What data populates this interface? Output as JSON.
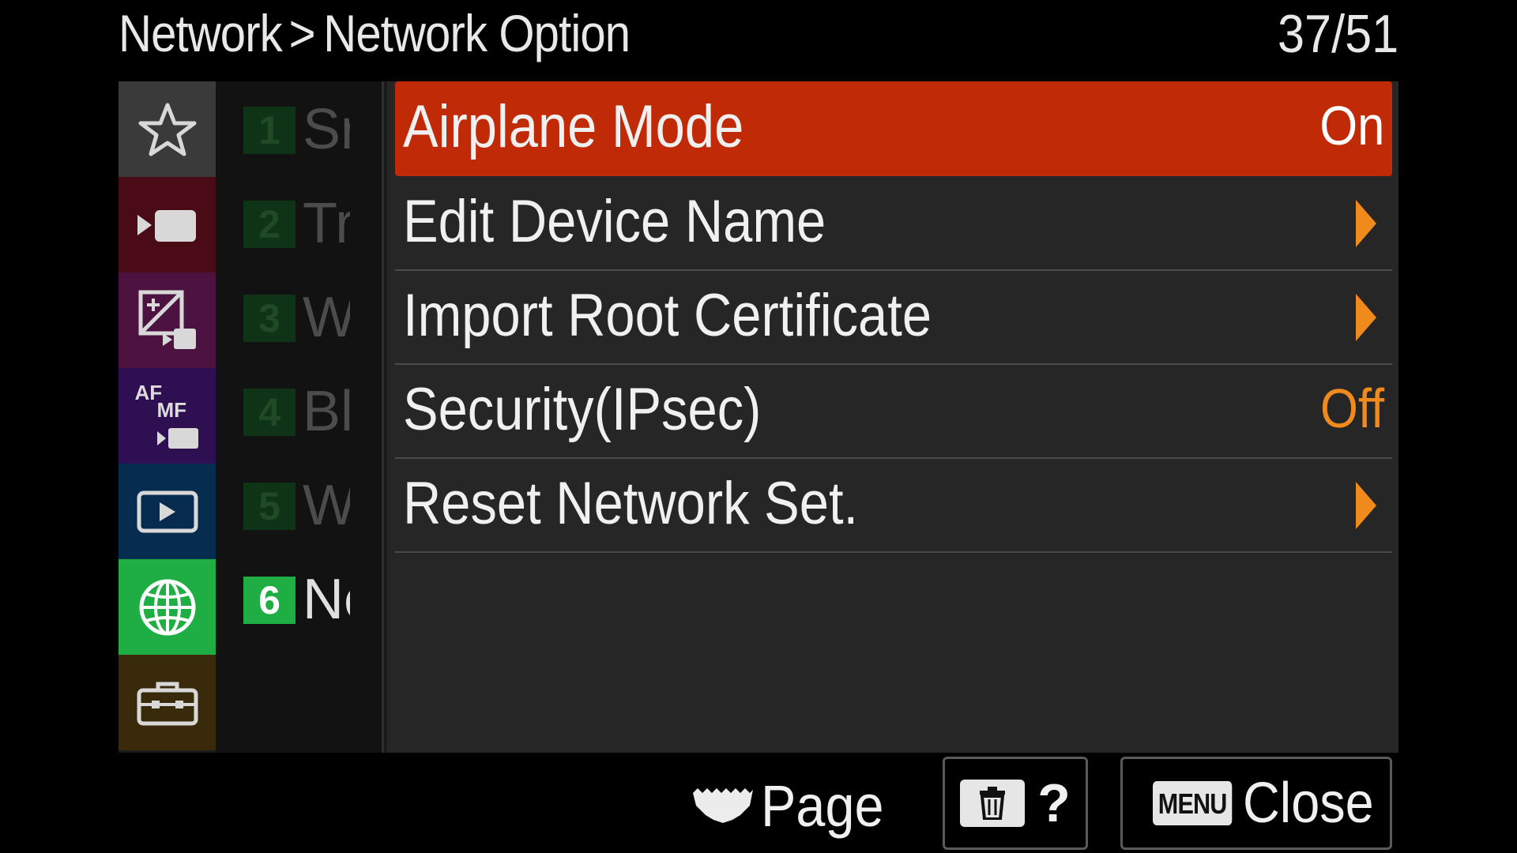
{
  "header": {
    "breadcrumb_parent": "Network",
    "breadcrumb_separator": ">",
    "breadcrumb_current": "Network Option",
    "page_count": "37/51"
  },
  "categories": [
    {
      "name": "star-icon",
      "color": "#3a3a3a"
    },
    {
      "name": "movie-shooting-icon",
      "color": "#4a0b16"
    },
    {
      "name": "exposure-color-icon",
      "color": "#4c1240"
    },
    {
      "name": "af-mf-icon",
      "color": "#2e0f52",
      "af_text": "AF",
      "mf_text": "MF"
    },
    {
      "name": "playback-icon",
      "color": "#062c50"
    },
    {
      "name": "globe-icon",
      "color": "#1fae43",
      "selected": true
    },
    {
      "name": "toolbox-icon",
      "color": "#3a2a0c"
    }
  ],
  "pages": [
    {
      "number": "1",
      "label": "Sr"
    },
    {
      "number": "2",
      "label": "Tr"
    },
    {
      "number": "3",
      "label": "W"
    },
    {
      "number": "4",
      "label": "Bl"
    },
    {
      "number": "5",
      "label": "W"
    },
    {
      "number": "6",
      "label": "Ne",
      "active": true
    }
  ],
  "menu": {
    "items": [
      {
        "label": "Airplane Mode",
        "value": "On",
        "selected": true
      },
      {
        "label": "Edit Device Name",
        "submenu": true
      },
      {
        "label": "Import Root Certificate",
        "submenu": true
      },
      {
        "label": "Security(IPsec)",
        "value": "Off"
      },
      {
        "label": "Reset Network Set.",
        "submenu": true
      }
    ]
  },
  "footer": {
    "page_label": "Page",
    "help_label": "?",
    "menu_key_label": "MENU",
    "close_label": "Close"
  },
  "colors": {
    "selected_row": "#c02a07",
    "value_off": "#f08a1c",
    "submenu_arrow": "#f08a1c",
    "active_category": "#1fae43"
  }
}
